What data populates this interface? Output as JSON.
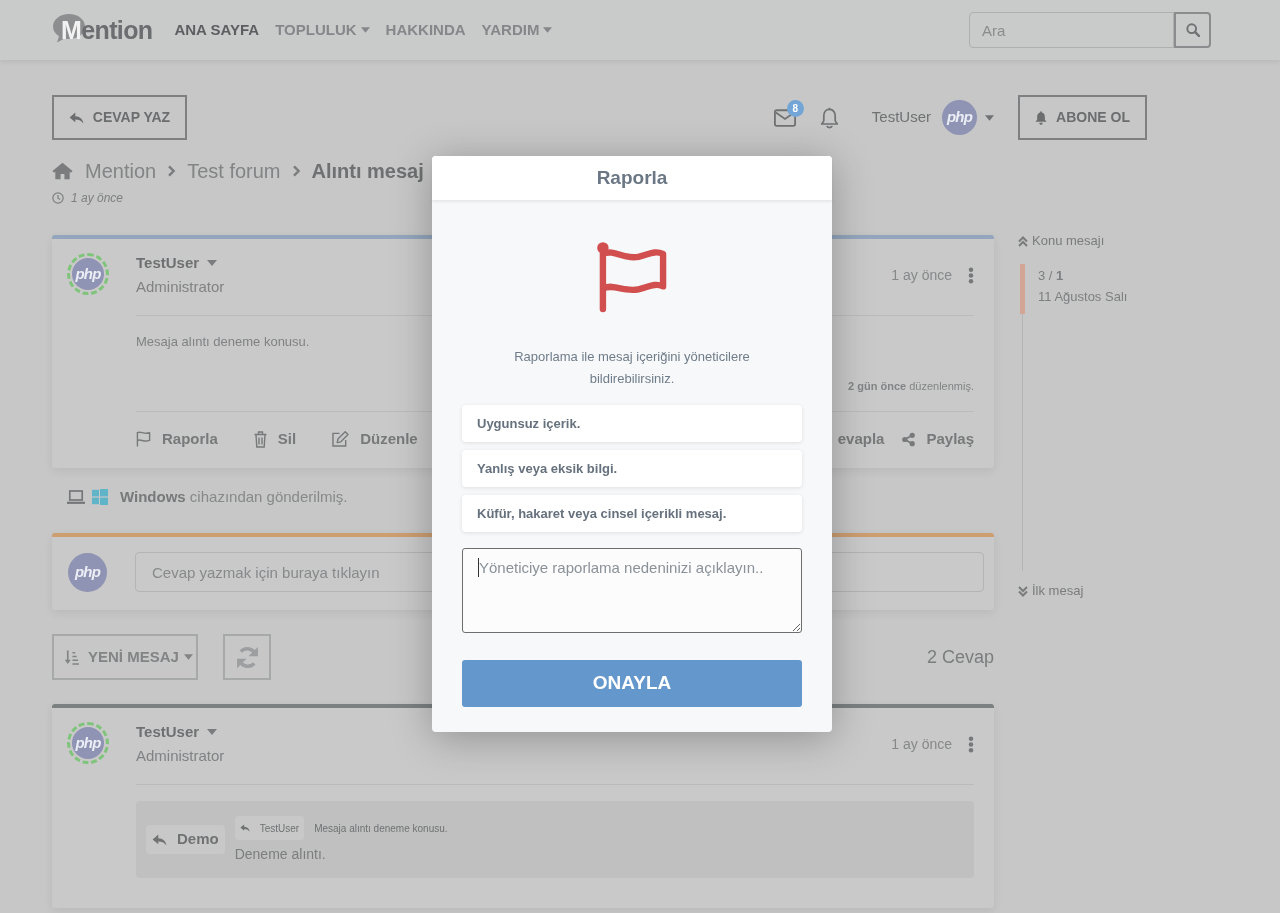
{
  "header": {
    "logo": "Mention",
    "nav": [
      {
        "label": "ANA SAYFA",
        "selected": true,
        "dropdown": false
      },
      {
        "label": "TOPLULUK",
        "selected": false,
        "dropdown": true
      },
      {
        "label": "HAKKINDA",
        "selected": false,
        "dropdown": false
      },
      {
        "label": "YARDIM",
        "selected": false,
        "dropdown": true
      }
    ],
    "search": {
      "placeholder": "Ara"
    }
  },
  "toolbar": {
    "reply_button": "CEVAP YAZ",
    "unread_count": "8",
    "user": {
      "name": "TestUser",
      "avatar": "php"
    },
    "subscribe_button": "ABONE OL"
  },
  "breadcrumb": [
    {
      "label": "Mention",
      "current": false
    },
    {
      "label": "Test forum",
      "current": false
    },
    {
      "label": "Alıntı mesaj",
      "current": true
    }
  ],
  "topic_date": "1 ay önce",
  "first_post": {
    "author": "TestUser",
    "avatar": "php",
    "ring": true,
    "role": "Administrator",
    "time": "1 ay önce",
    "body": "Mesaja alıntı deneme konusu.",
    "edited": "**2 gün önce** düzenlenmiş.",
    "actions": [
      {
        "kind": "report",
        "label": "Raporla"
      },
      {
        "kind": "delete",
        "label": "Sil"
      },
      {
        "kind": "edit",
        "label": "Düzenle"
      }
    ],
    "actions_end": [
      {
        "kind": "reply",
        "label": "evapla"
      },
      {
        "kind": "share",
        "label": "Paylaş"
      }
    ],
    "device": "**Windows** cihazından gönderilmiş."
  },
  "reply_box": {
    "avatar": "php",
    "placeholder": "Cevap yazmak için buraya tıklayın"
  },
  "replies_bar": {
    "sort_button": "YENİ MESAJ",
    "count": "2 Cevap"
  },
  "replies": [
    {
      "author": "TestUser",
      "avatar": "php",
      "ring": true,
      "role": "Administrator",
      "time": "1 ay önce",
      "quote": {
        "button": "Demo",
        "author": "TestUser",
        "source": "Mesaja alıntı deneme konusu.",
        "text": "Deneme alıntı."
      }
    }
  ],
  "timeline": {
    "top": "Konu mesajı",
    "position": "3 / **1**",
    "date": "11 Ağustos Salı",
    "bottom": "İlk mesaj"
  },
  "modal": {
    "title": "Raporla",
    "description": "Raporlama ile mesaj içeriğini yöneticilere bildirebilirsiniz.",
    "reasons": [
      {
        "label": "Uygunsuz içerik.",
        "selected": false
      },
      {
        "label": "Yanlış veya eksik bilgi.",
        "selected": false
      },
      {
        "label": "Küfür, hakaret veya cinsel içerikli mesaj.",
        "selected": false
      }
    ],
    "textarea": {
      "placeholder": "Yöneticiye raporlama nedeninizi açıklayın..",
      "focused": true
    },
    "confirm_button": "ONAYLA"
  }
}
